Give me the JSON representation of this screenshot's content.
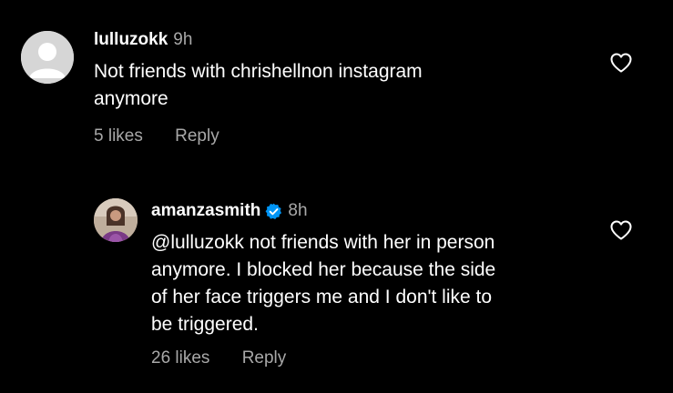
{
  "comments": [
    {
      "username": "lulluzokk",
      "time": "9h",
      "text_lines": [
        "Not friends with chrishellnon instagram",
        "anymore"
      ],
      "likes": "5 likes",
      "reply_label": "Reply",
      "avatar_icon": "default-avatar-icon",
      "like_icon": "heart-outline-icon"
    },
    {
      "username": "amanzasmith",
      "verified": true,
      "time": "8h",
      "text_lines": [
        "@lulluzokk not friends with her in person",
        "anymore. I blocked her because the side",
        "of her face triggers me and I don't like to",
        "be triggered."
      ],
      "likes": "26 likes",
      "reply_label": "Reply",
      "avatar_icon": "profile-photo",
      "like_icon": "heart-outline-icon"
    }
  ],
  "colors": {
    "background": "#000000",
    "primary_text": "#ffffff",
    "secondary_text": "#a8a8a8",
    "verified_badge": "#0095f6"
  }
}
